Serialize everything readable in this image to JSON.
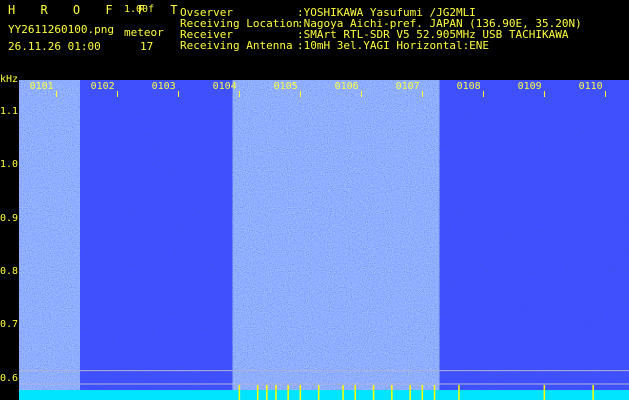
{
  "header": {
    "app_title": "H R O F F T",
    "version": "1.00f",
    "filename": "YY2611260100.png",
    "mode_label": "meteor",
    "datetime": "26.11.26 01:00",
    "count": "17"
  },
  "info": [
    {
      "label": "Ovserver",
      "value": ":YOSHIKAWA Yasufumi /JG2MLI"
    },
    {
      "label": "Receiving Location",
      "value": ":Nagoya Aichi-pref. JAPAN (136.90E, 35.20N)"
    },
    {
      "label": "Receiver",
      "value": ":SMArt RTL-SDR V5 52.905MHz USB TACHIKAWA"
    },
    {
      "label": "Receiving Antenna",
      "value": ":10mH 3el.YAGI Horizontal:ENE"
    }
  ],
  "axis": {
    "unit": "kHz",
    "y_ticks": [
      "1.1",
      "1.0",
      "0.9",
      "0.8",
      "0.7",
      "0.6"
    ],
    "x_ticks": [
      "0101",
      "0102",
      "0103",
      "0104",
      "0105",
      "0106",
      "0107",
      "0108",
      "0109",
      "0110"
    ]
  },
  "colors": {
    "background": "#000000",
    "text": "#ffff40",
    "noise_low": "#0a0a6e",
    "noise_high": "#2d3bff",
    "baseline": "#00e5ff",
    "meteor": "#ffff00"
  },
  "chart_data": {
    "type": "heatmap",
    "xlabel": "",
    "ylabel": "kHz",
    "ylim": [
      0.56,
      1.16
    ],
    "x_labels": [
      "0101",
      "0102",
      "0103",
      "0104",
      "0105",
      "0106",
      "0107",
      "0108",
      "0109",
      "0110"
    ],
    "intensity_bands": [
      {
        "from_minute": 0,
        "to_minute": 1,
        "level": 0.75
      },
      {
        "from_minute": 1,
        "to_minute": 3.5,
        "level": 0.45
      },
      {
        "from_minute": 3.5,
        "to_minute": 6.9,
        "level": 0.85
      },
      {
        "from_minute": 6.9,
        "to_minute": 10,
        "level": 0.45
      }
    ],
    "reference_lines_khz": [
      0.615,
      0.59
    ]
  }
}
